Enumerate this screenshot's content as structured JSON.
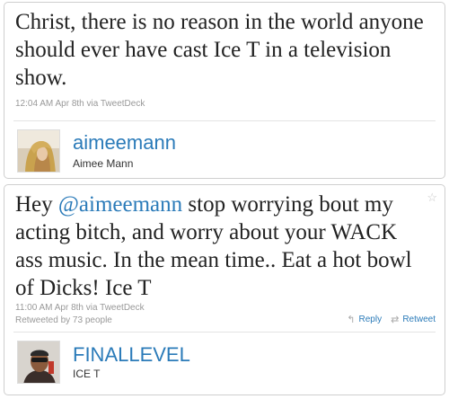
{
  "tweet1": {
    "text": "Christ, there is no reason in the world anyone should ever have cast Ice T in a television show.",
    "timestamp": "12:04 AM Apr 8th via TweetDeck",
    "screen_name": "aimeemann",
    "full_name": "Aimee Mann",
    "avatar_icon": "profile-photo-aimee"
  },
  "tweet2": {
    "text_before": "Hey ",
    "mention": "@aimeemann",
    "text_after": " stop worrying bout my acting bitch, and worry about your WACK ass music. In the mean time.. Eat a hot bowl of Dicks! Ice T",
    "timestamp": "11:00 AM Apr 8th via TweetDeck",
    "retweet_info": "Retweeted by 73 people",
    "reply_label": "Reply",
    "retweet_label": "Retweet",
    "screen_name": "FINALLEVEL",
    "full_name": "ICE T",
    "avatar_icon": "profile-photo-icet"
  },
  "colors": {
    "link": "#2b7bb9",
    "meta": "#999999",
    "border": "#cfcfcf"
  },
  "icons": {
    "favorite": "star-icon",
    "reply": "reply-arrow-icon",
    "retweet": "retweet-icon"
  }
}
